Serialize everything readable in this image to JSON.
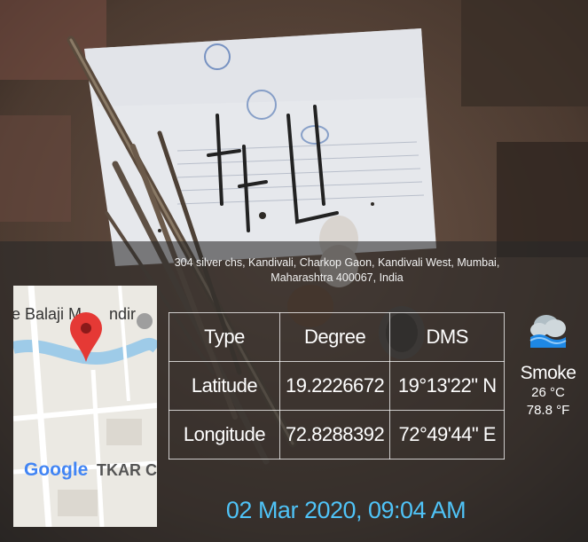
{
  "address": {
    "line1": "304 silver chs, Kandivali, Charkop Gaon, Kandivali West, Mumbai,",
    "line2": "Maharashtra 400067, India"
  },
  "map": {
    "label_top": "e Balaji M",
    "label_top_right": "ndir",
    "logo": "Google",
    "label_bottom": "TKAR C",
    "pin_color": "#e53935"
  },
  "table": {
    "headers": [
      "Type",
      "Degree",
      "DMS"
    ],
    "rows": [
      [
        "Latitude",
        "19.2226672",
        "19°13'22\" N"
      ],
      [
        "Longitude",
        "72.8288392",
        "72°49'44\" E"
      ]
    ]
  },
  "weather": {
    "icon": "smoke-cloud-icon",
    "condition": "Smoke",
    "temp_c": "26 °C",
    "temp_f": "78.8 °F"
  },
  "timestamp": "02 Mar 2020, 09:04 AM",
  "colors": {
    "timestamp": "#4fc3f7",
    "weather_icon": "#1e88e5"
  }
}
